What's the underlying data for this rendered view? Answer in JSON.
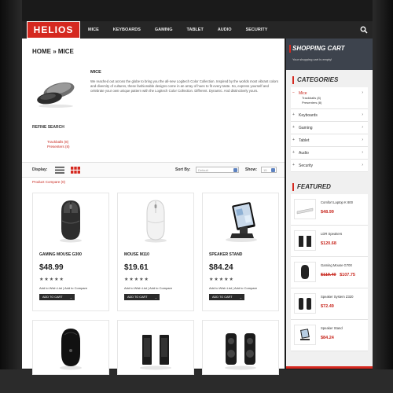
{
  "header": {
    "logo": "HELIOS",
    "nav": [
      "MICE",
      "KEYBOARDS",
      "GAMING",
      "TABLET",
      "AUDIO",
      "SECURITY"
    ]
  },
  "breadcrumb": "HOME » MICE",
  "category": {
    "title": "MICE",
    "description": "We reached out across the globe to bring you the all-new Logitech Color Collection. Inspired by the worlds most vibrant colors and diversity of cultures, these fashionable designs come in an array of hues to fit every taste. So, express yourself and celebrate your own unique pattern with the Logitech Color Collection. Different. Dynamic. And distinctively yours."
  },
  "refine": {
    "title": "REFINE SEARCH",
    "links": [
      "Trackballs (8)",
      "Presenters (8)"
    ]
  },
  "toolbar": {
    "display_label": "Display:",
    "sort_label": "Sort By:",
    "sort_value": "Default",
    "show_label": "Show:",
    "show_value": "15"
  },
  "compare_link": "Product Compare (0)",
  "products": [
    {
      "name": "GAMING MOUSE G300",
      "price": "$48.99",
      "stars": "★★★★★",
      "wishlist": "Add to Wish List",
      "compare": "Add to Compare",
      "cart": "ADD TO CART"
    },
    {
      "name": "MOUSE M110",
      "price": "$19.61",
      "stars": "★★★★★",
      "wishlist": "Add to Wish List",
      "compare": "Add to Compare",
      "cart": "ADD TO CART"
    },
    {
      "name": "SPEAKER STAND",
      "price": "$84.24",
      "stars": "★★★★★",
      "wishlist": "Add to Wish List",
      "compare": "Add to Compare",
      "cart": "ADD TO CART"
    }
  ],
  "sidebar": {
    "cart": {
      "title": "SHOPPING CART",
      "note": "Your shopping cart is empty!"
    },
    "categories_title": "CATEGORIES",
    "categories": [
      {
        "label": "Mice",
        "subs": [
          "Trackballs (8)",
          "Presenters (8)"
        ]
      },
      {
        "label": "Keyboards"
      },
      {
        "label": "Gaming"
      },
      {
        "label": "Tablet"
      },
      {
        "label": "Audio"
      },
      {
        "label": "Security"
      }
    ],
    "featured_title": "FEATURED",
    "featured": [
      {
        "name": "Comfort Laptop K 800",
        "price": "$48.99",
        "old": ""
      },
      {
        "name": "LDR Speakers",
        "price": "$120.68",
        "old": ""
      },
      {
        "name": "Gaming Mouse G700",
        "price": "$107.75",
        "old": "$119.49"
      },
      {
        "name": "Speaker System Z320",
        "price": "$72.49",
        "old": ""
      },
      {
        "name": "Speaker Stand",
        "price": "$84.24",
        "old": ""
      }
    ]
  },
  "colors": {
    "accent": "#d5281f",
    "dark": "#262626",
    "sidebar_header": "#3d434d"
  }
}
